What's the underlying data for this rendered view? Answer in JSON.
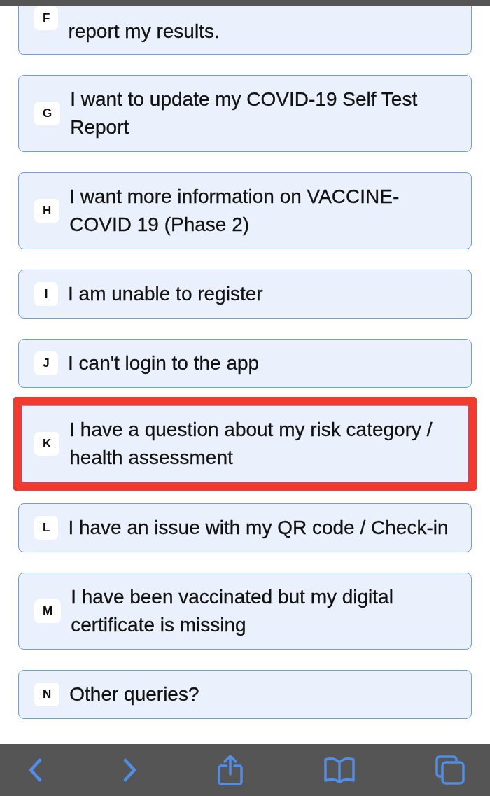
{
  "options": [
    {
      "kind": "clipped",
      "letter": "F",
      "text": "report my results.",
      "highlighted": false
    },
    {
      "kind": "full",
      "letter": "G",
      "text": "I want to update my COVID-19 Self Test Report",
      "highlighted": false
    },
    {
      "kind": "full",
      "letter": "H",
      "text": "I want more information on VACCINE-COVID 19 (Phase 2)",
      "highlighted": false
    },
    {
      "kind": "full",
      "letter": "I",
      "text": "I am unable to register",
      "highlighted": false
    },
    {
      "kind": "full",
      "letter": "J",
      "text": "I can't login to the app",
      "highlighted": false
    },
    {
      "kind": "full",
      "letter": "K",
      "text": "I have a question about my risk category / health assessment",
      "highlighted": true
    },
    {
      "kind": "full",
      "letter": "L",
      "text": "I have an issue with my QR code / Check-in",
      "highlighted": false
    },
    {
      "kind": "full",
      "letter": "M",
      "text": "I have been vaccinated but my digital certificate is missing",
      "highlighted": false
    },
    {
      "kind": "full",
      "letter": "N",
      "text": "Other queries?",
      "highlighted": false
    }
  ],
  "toolbar": {
    "buttons": [
      {
        "kind": "back"
      },
      {
        "kind": "forward"
      },
      {
        "kind": "share"
      },
      {
        "kind": "bookmarks"
      },
      {
        "kind": "tabs"
      }
    ]
  }
}
